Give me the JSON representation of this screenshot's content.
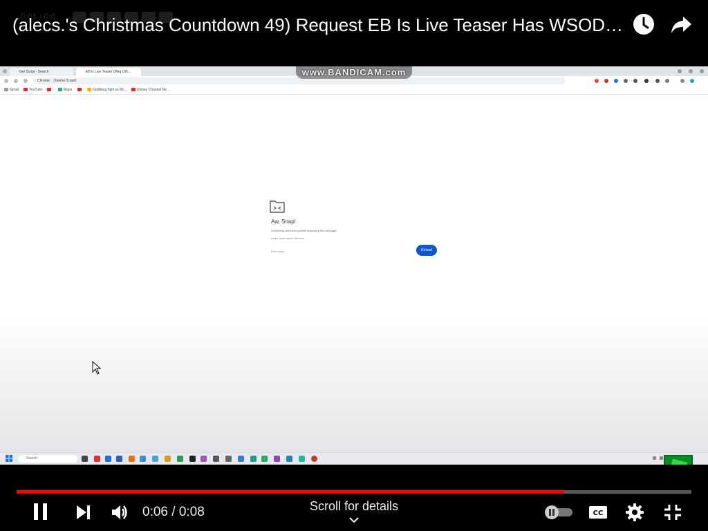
{
  "header": {
    "title": "(alecs.'s Christmas Countdown 49) Request EB Is Live Teaser Has WSOD…",
    "ghost_time": "0:01 / 0:0",
    "watch_later_icon": "clock-icon",
    "share_icon": "share-arrow-icon"
  },
  "video": {
    "watermark": "www.BANDICAM.com",
    "browser": {
      "tabs": [
        "Get Script - Search",
        "EB is Live Teaser (Meg Oth…"
      ],
      "site_chip": "Chrome",
      "address": "chrome://crash",
      "bookmarks": [
        "Gmail",
        "YouTube",
        "",
        "Maps",
        "",
        "Goldberg fight vs Mr…",
        "Disney Channel Ne…"
      ]
    },
    "error": {
      "heading": "Aw, Snap!",
      "description": "Something went wrong while displaying this webpage.",
      "more": "Learn more about this error",
      "code": "Error code: ",
      "reload_label": "Reload"
    },
    "taskbar": {
      "search_placeholder": "Search",
      "clock_time": "",
      "clock_date": ""
    }
  },
  "player": {
    "progress": 0.81,
    "current_time": "0:06",
    "duration": "0:08",
    "time_display": "0:06 / 0:08",
    "scroll_hint": "Scroll for details",
    "controls": [
      "pause-icon",
      "next-icon",
      "volume-icon",
      "autoplay-toggle",
      "captions-icon",
      "settings-gear-icon",
      "exit-fullscreen-icon"
    ],
    "progress_color": "#ff0000"
  },
  "colors": {
    "background": "#000000",
    "reload_button": "#0b57d0",
    "overlay_green": "#35d94a"
  }
}
